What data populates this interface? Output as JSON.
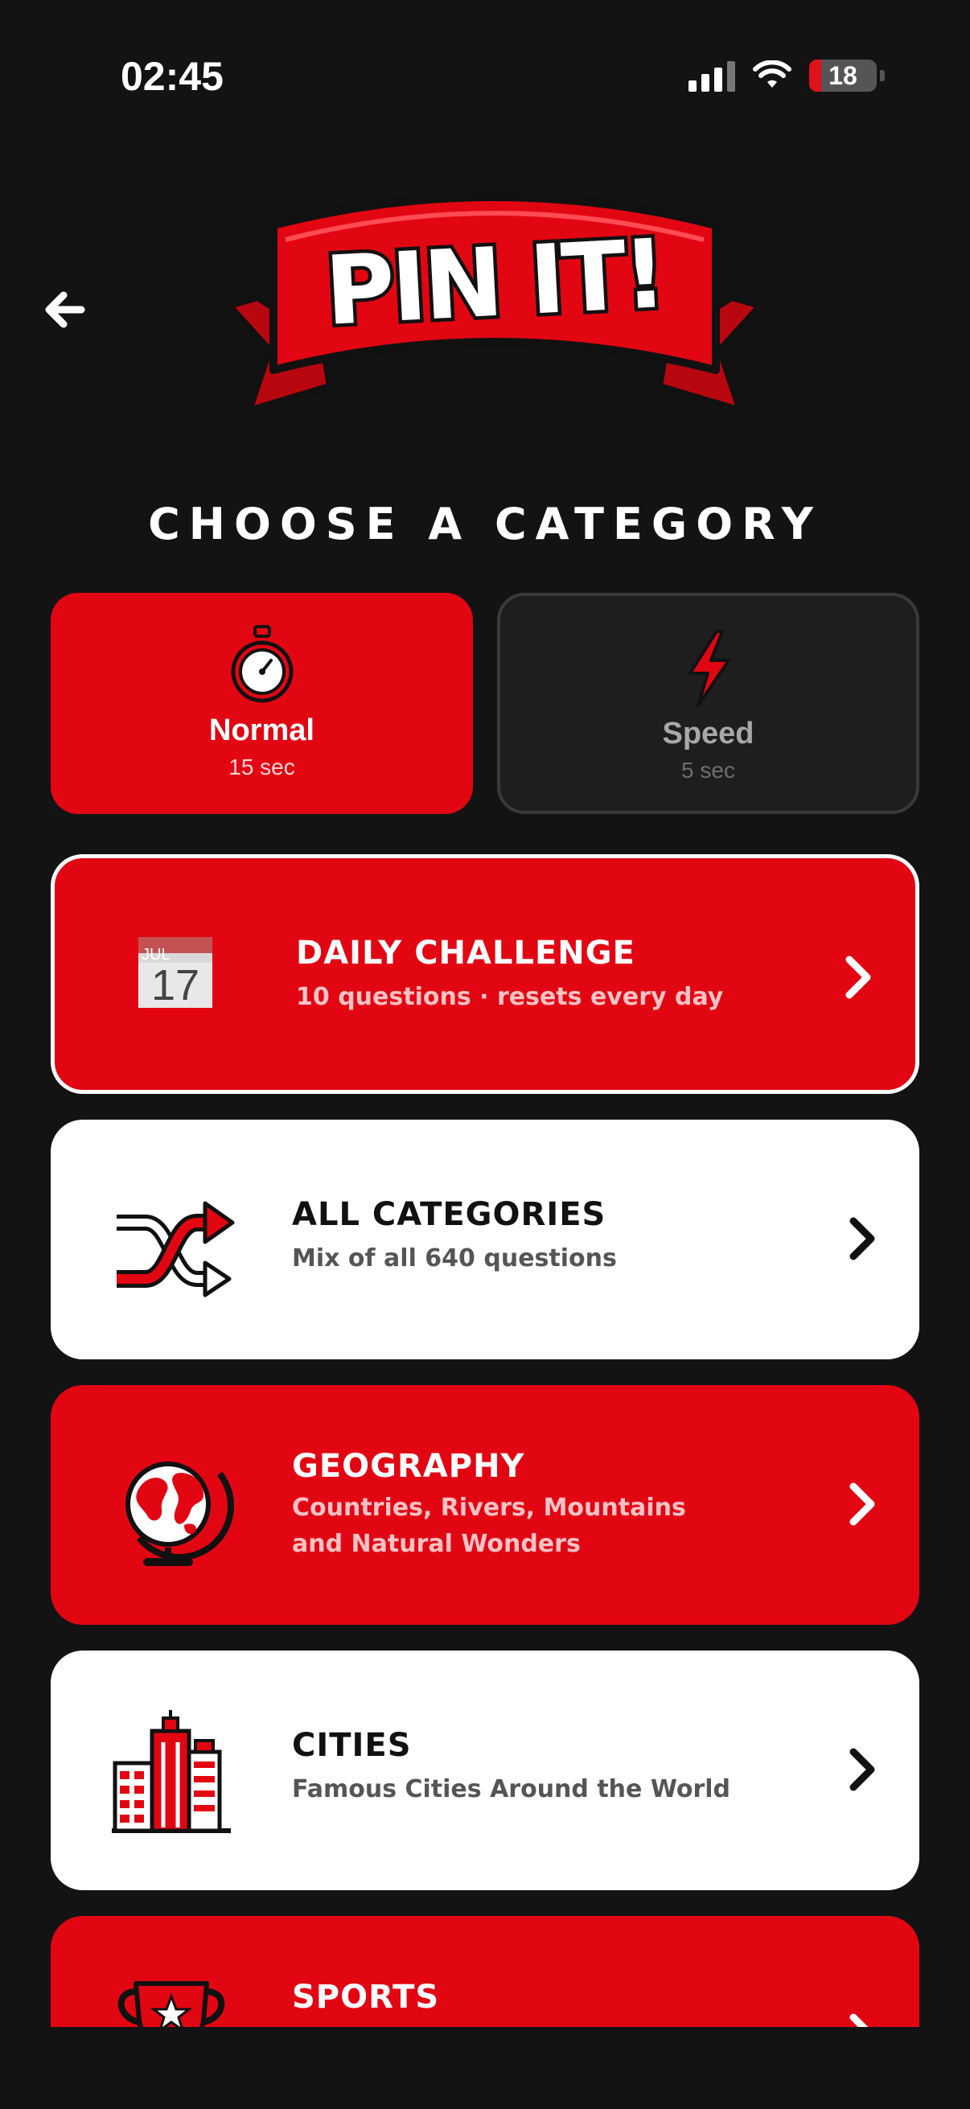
{
  "status_bar": {
    "time": "02:45",
    "battery": "18",
    "battery_level": 0.18
  },
  "header": {
    "back_icon": "arrow-left-icon",
    "logo_text": "PIN IT!"
  },
  "section_title": "CHOOSE A CATEGORY",
  "modes": [
    {
      "label": "Normal",
      "sub": "15 sec",
      "icon": "stopwatch-icon",
      "selected": true
    },
    {
      "label": "Speed",
      "sub": "5 sec",
      "icon": "lightning-icon",
      "selected": false
    }
  ],
  "categories": [
    {
      "title": "DAILY CHALLENGE",
      "desc": "10 questions · resets every day",
      "icon": "calendar-icon",
      "calendar_month": "JUL",
      "calendar_day": "17"
    },
    {
      "title": "ALL CATEGORIES",
      "desc": "Mix of all 640 questions",
      "icon": "shuffle-icon"
    },
    {
      "title": "GEOGRAPHY",
      "desc_line1": "Countries, Rivers, Mountains",
      "desc_line2": "and Natural Wonders",
      "icon": "globe-icon"
    },
    {
      "title": "CITIES",
      "desc": "Famous Cities Around the World",
      "icon": "buildings-icon"
    },
    {
      "title": "SPORTS",
      "icon": "trophy-icon"
    }
  ],
  "colors": {
    "background": "#131314",
    "accent_red": "#e20613",
    "card_white": "#ffffff",
    "card_dark": "#1e1e1f"
  }
}
